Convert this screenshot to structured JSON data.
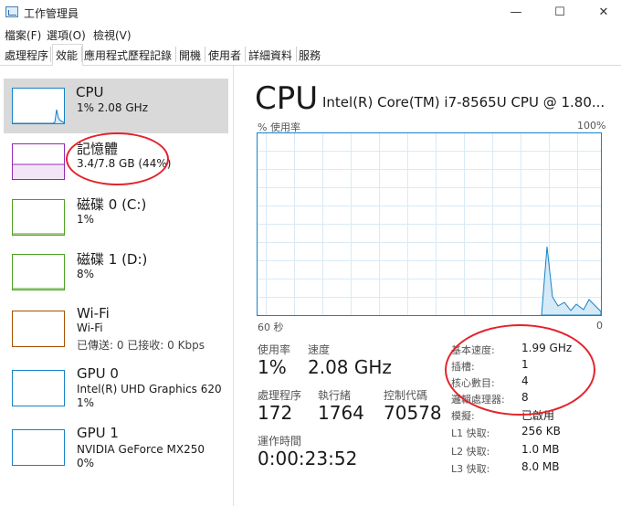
{
  "window": {
    "title": "工作管理員",
    "minimize": "—",
    "maximize": "☐",
    "close": "✕"
  },
  "menu": [
    "檔案(F)",
    "選項(O)",
    "檢視(V)"
  ],
  "tabs": [
    "處理程序",
    "效能",
    "應用程式歷程記錄",
    "開機",
    "使用者",
    "詳細資料",
    "服務"
  ],
  "active_tab": "效能",
  "sidebar": [
    {
      "name": "CPU",
      "sub": "1% 2.08 GHz",
      "color": "#1482c8"
    },
    {
      "name": "記憶體",
      "sub": "3.4/7.8 GB (44%)",
      "color": "#9528b4"
    },
    {
      "name": "磁碟 0 (C:)",
      "sub": "1%",
      "color": "#4ca022"
    },
    {
      "name": "磁碟 1 (D:)",
      "sub": "8%",
      "color": "#4ca022"
    },
    {
      "name": "Wi-Fi",
      "sub": "Wi-Fi",
      "sub2": "已傳送: 0 已接收: 0 Kbps",
      "color": "#a74f01"
    },
    {
      "name": "GPU 0",
      "sub": "Intel(R) UHD Graphics 620",
      "sub2": "1%",
      "color": "#1482c8"
    },
    {
      "name": "GPU 1",
      "sub": "NVIDIA GeForce MX250",
      "sub2": "0%",
      "color": "#1482c8"
    }
  ],
  "main": {
    "title": "CPU",
    "model": "Intel(R) Core(TM) i7-8565U CPU @ 1.80...",
    "graph_label_left": "% 使用率",
    "graph_label_right": "100%",
    "graph_bottom_left": "60 秒",
    "graph_bottom_right": "0",
    "graph_color": "#1482c8",
    "usage_label": "使用率",
    "usage_value": "1%",
    "speed_label": "速度",
    "speed_value": "2.08 GHz",
    "proc_label": "處理程序",
    "proc_value": "172",
    "threads_label": "執行緒",
    "threads_value": "1764",
    "handles_label": "控制代碼",
    "handles_value": "70578",
    "uptime_label": "運作時間",
    "uptime_value": "0:00:23:52",
    "specs": [
      {
        "label": "基本速度:",
        "value": "1.99 GHz"
      },
      {
        "label": "插槽:",
        "value": "1"
      },
      {
        "label": "核心數目:",
        "value": "4"
      },
      {
        "label": "邏輯處理器:",
        "value": "8"
      },
      {
        "label": "模擬:",
        "value": "已啟用"
      },
      {
        "label": "L1 快取:",
        "value": "256 KB"
      },
      {
        "label": "L2 快取:",
        "value": "1.0 MB"
      },
      {
        "label": "L3 快取:",
        "value": "8.0 MB"
      }
    ]
  }
}
